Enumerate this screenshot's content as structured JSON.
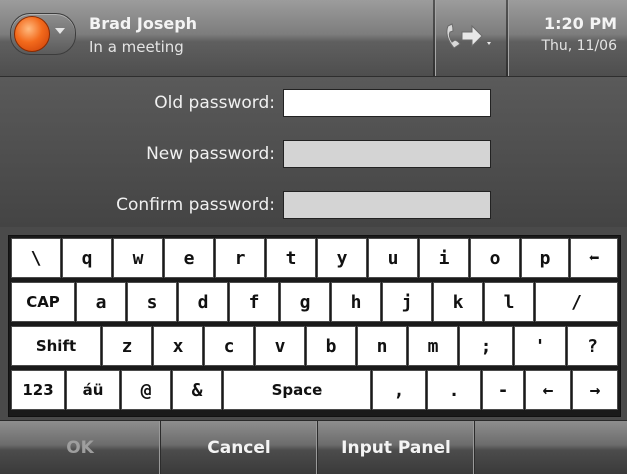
{
  "title_bar": {
    "user_name": "Brad Joseph",
    "user_status": "In a meeting",
    "time": "1:20 PM",
    "date": "Thu, 11/06",
    "presence_color": "#f36a1c"
  },
  "form": {
    "old_password_label": "Old password:",
    "new_password_label": "New password:",
    "confirm_password_label": "Confirm password:",
    "old_password_value": "",
    "new_password_value": "",
    "confirm_password_value": ""
  },
  "keyboard": {
    "row1": [
      "\\",
      "q",
      "w",
      "e",
      "r",
      "t",
      "y",
      "u",
      "i",
      "o",
      "p",
      "⬅"
    ],
    "row2": [
      "CAP",
      "a",
      "s",
      "d",
      "f",
      "g",
      "h",
      "j",
      "k",
      "l",
      "/"
    ],
    "row3": [
      "Shift",
      "z",
      "x",
      "c",
      "v",
      "b",
      "n",
      "m",
      ";",
      "'",
      "?"
    ],
    "row4": [
      "123",
      "áü",
      "@",
      "&",
      "Space",
      ",",
      ".",
      "-",
      "←",
      "→"
    ]
  },
  "menu": {
    "left": "OK",
    "center": "Cancel",
    "right": "Input Panel",
    "ok_enabled": false
  }
}
